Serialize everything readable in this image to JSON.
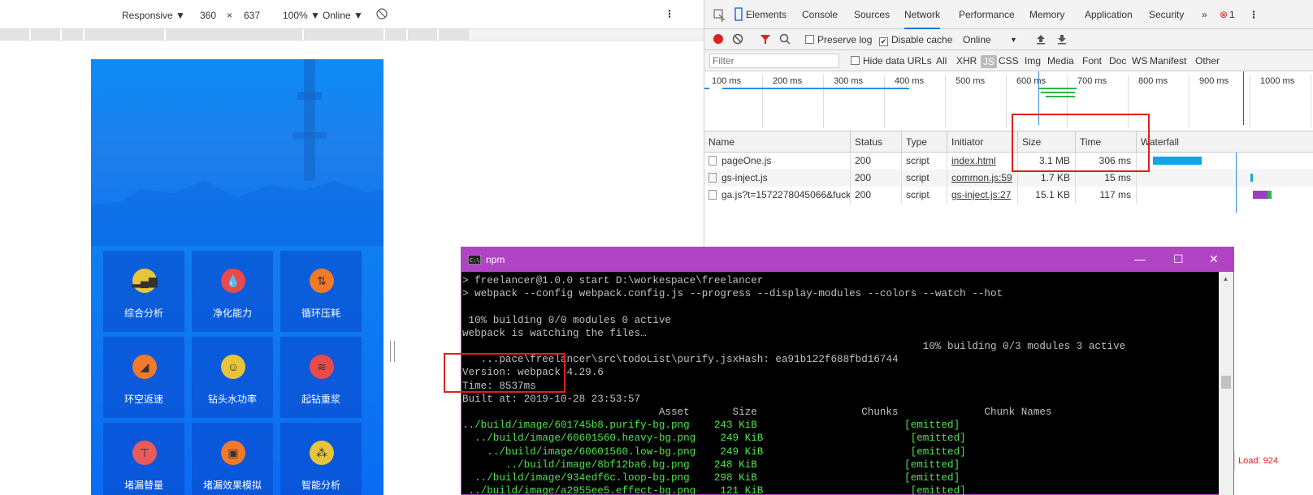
{
  "device_toolbar": {
    "device": "Responsive ▼",
    "width": "360",
    "times": "×",
    "height": "637",
    "zoom": "100% ▼",
    "throttle": "Online ▼",
    "rotate_icon": "rotate-icon",
    "more_icon": "kebab-menu-icon"
  },
  "phone": {
    "menu": [
      {
        "label": "综合分析",
        "icon": "signal-bars-icon",
        "color": "#e8c43a"
      },
      {
        "label": "净化能力",
        "icon": "water-drop-icon",
        "color": "#ea4a4a"
      },
      {
        "label": "循环压耗",
        "icon": "cycle-arrows-icon",
        "color": "#f07a2a"
      },
      {
        "label": "环空返速",
        "icon": "leaf-icon",
        "color": "#f07a2a"
      },
      {
        "label": "钻头水功率",
        "icon": "person-wave-icon",
        "color": "#e8c43a"
      },
      {
        "label": "起钻重浆",
        "icon": "wave-bowl-icon",
        "color": "#ea4a4a"
      },
      {
        "label": "堵漏替量",
        "icon": "plug-icon",
        "color": "#ea5a5a"
      },
      {
        "label": "堵漏效果模拟",
        "icon": "crate-icon",
        "color": "#f07a2a"
      },
      {
        "label": "智能分析",
        "icon": "network-nodes-icon",
        "color": "#e8c43a"
      }
    ]
  },
  "devtools": {
    "tabs": [
      "Elements",
      "Console",
      "Sources",
      "Network",
      "Performance",
      "Memory",
      "Application",
      "Security"
    ],
    "active_tab": "Network",
    "more_tabs": "»",
    "error_count": "1",
    "row2": {
      "preserve_log": "Preserve log",
      "disable_cache": "Disable cache",
      "online": "Online",
      "online_arrow": "▼"
    },
    "row3": {
      "filter_placeholder": "Filter",
      "hide_data_urls": "Hide data URLs",
      "types": [
        "All",
        "XHR",
        "JS",
        "CSS",
        "Img",
        "Media",
        "Font",
        "Doc",
        "WS",
        "Manifest",
        "Other"
      ]
    },
    "overview_ticks": [
      "100 ms",
      "200 ms",
      "300 ms",
      "400 ms",
      "500 ms",
      "600 ms",
      "700 ms",
      "800 ms",
      "900 ms",
      "1000 ms"
    ],
    "columns": [
      "Name",
      "Status",
      "Type",
      "Initiator",
      "Size",
      "Time",
      "Waterfall"
    ],
    "rows": [
      {
        "name": "pageOne.js",
        "status": "200",
        "type": "script",
        "initiator": "index.html",
        "size": "3.1 MB",
        "time": "306 ms"
      },
      {
        "name": "gs-inject.js",
        "status": "200",
        "type": "script",
        "initiator": "common.js:59",
        "size": "1.7 KB",
        "time": "15 ms"
      },
      {
        "name": "ga.js?t=1572278045066&fuckgfw...",
        "status": "200",
        "type": "script",
        "initiator": "gs-inject.js:27",
        "size": "15.1 KB",
        "time": "117 ms"
      }
    ],
    "corner_text": "Load: 924"
  },
  "terminal": {
    "title": "npm",
    "lines": [
      {
        "text": "> freelancer@1.0.0 start D:\\workespace\\freelancer",
        "green": false
      },
      {
        "text": "> webpack --config webpack.config.js --progress --display-modules --colors --watch --hot",
        "green": false
      },
      {
        "text": "",
        "green": false
      },
      {
        "text": " 10% building 0/0 modules 0 active",
        "green": false
      },
      {
        "text": "webpack is watching the files…",
        "green": false
      },
      {
        "text": "                                                                           10% building 0/3 modules 3 active",
        "green": false
      },
      {
        "text": "   ...pace\\freelancer\\src\\todoList\\purify.jsxHash: ea91b122f688fbd16744",
        "green": false
      },
      {
        "text": "Version: webpack 4.29.6",
        "green": false
      },
      {
        "text": "Time: 8537ms",
        "green": false
      },
      {
        "text": "Built at: 2019-10-28 23:53:57",
        "green": false
      },
      {
        "text": "                                Asset       Size                 Chunks              Chunk Names",
        "green": false
      },
      {
        "text": "../build/image/601745b8.purify-bg.png    243 KiB                        [emitted]",
        "green": true
      },
      {
        "text": "  ../build/image/60601560.heavy-bg.png    249 KiB                        [emitted]",
        "green": true
      },
      {
        "text": "    ../build/image/60601560.low-bg.png    249 KiB                        [emitted]",
        "green": true
      },
      {
        "text": "       ../build/image/8bf12ba6.bg.png    248 KiB                        [emitted]",
        "green": true
      },
      {
        "text": "  ../build/image/934edf6c.loop-bg.png    298 KiB                        [emitted]",
        "green": true
      },
      {
        "text": " ../build/image/a2955ee5.effect-bg.png    121 KiB                        [emitted]",
        "green": true
      }
    ]
  },
  "colors": {
    "accent": "#1a73e8",
    "record": "#e0201f",
    "terminal_title": "#b044c4",
    "annotation": "#e0201f"
  }
}
